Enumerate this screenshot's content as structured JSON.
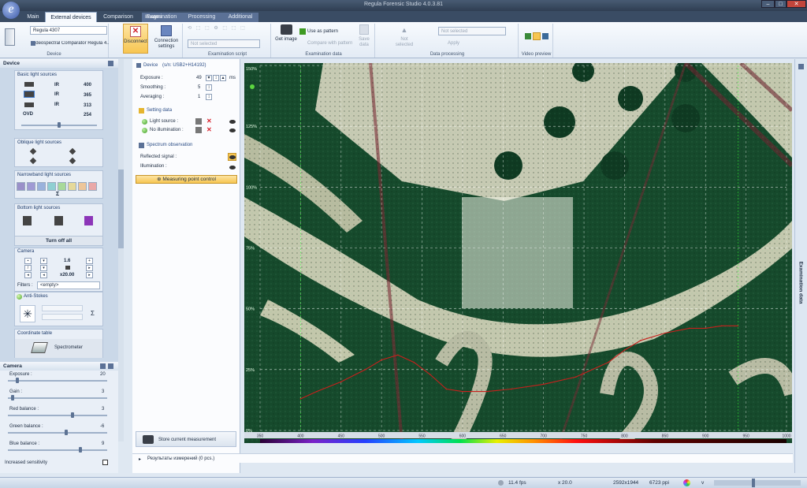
{
  "window": {
    "title": "Regula Forensic Studio 4.0.3.81",
    "context_tab": "Images"
  },
  "tabs": [
    {
      "label": "Main",
      "active": false
    },
    {
      "label": "External devices",
      "active": true
    },
    {
      "label": "Comparison",
      "active": false
    },
    {
      "label": "Examination",
      "active": false
    },
    {
      "label": "Processing",
      "active": false
    },
    {
      "label": "Additional",
      "active": false
    }
  ],
  "ribbon": {
    "device": {
      "combo": "Regula 4307",
      "desc": "Videospectral Comparator Regula 4...",
      "group": "Device"
    },
    "disconnect": "Disconnect",
    "connection_settings": "Connection settings",
    "script": {
      "combo": "Not selected",
      "group": "Examination script"
    },
    "get_image": "Get image",
    "use_as_pattern": "Use as pattern",
    "compare_with_pattern": "Compare with pattern",
    "save_data": "Save data",
    "exam_group": "Examination data",
    "not_selected": "Not selected",
    "processing": {
      "combo": "Not selected",
      "apply": "Apply",
      "group": "Data processing"
    },
    "video_group": "Video preview"
  },
  "device_panel": {
    "title": "Device",
    "basic": {
      "title": "Basic light sources",
      "rows": [
        {
          "tag": "IR",
          "value": "400"
        },
        {
          "tag": "IR",
          "value": "365"
        },
        {
          "tag": "IR",
          "value": "313"
        },
        {
          "tag": "OVD",
          "value": "254"
        }
      ]
    },
    "oblique": "Oblique light sources",
    "narrowband": {
      "title": "Narrowband light sources",
      "sigma": "Σ"
    },
    "bottom": {
      "title": "Bottom light sources",
      "turn_off": "Turn off all"
    },
    "camera": {
      "title": "Camera",
      "zoom": "1.6",
      "mag": "x20.00",
      "filters_label": "Filters :",
      "filters_value": "<empty>"
    },
    "anti_stokes": "Anti-Stokes",
    "coordinate_table": "Coordinate table",
    "spectrometer": "Spectrometer"
  },
  "camera_panel": {
    "title": "Camera",
    "exposure": {
      "label": "Exposure :",
      "value": "20"
    },
    "gain": {
      "label": "Gain :",
      "value": "3"
    },
    "red": {
      "label": "Red balance :",
      "value": "3"
    },
    "green": {
      "label": "Green balance :",
      "value": "-6"
    },
    "blue": {
      "label": "Blue balance :",
      "value": "9"
    },
    "increased_sensitivity": "Increased sensitivity"
  },
  "spectro": {
    "device": "Device",
    "serial": "(s/n: USB2+H14192)",
    "exposure": {
      "label": "Exposure :",
      "value": "49",
      "unit": "ms"
    },
    "smoothing": {
      "label": "Smoothing :",
      "value": "5"
    },
    "averaging": {
      "label": "Averaging :",
      "value": "1"
    },
    "setting_data": "Setting data",
    "light_source": "Light source :",
    "no_illumination": "No illumination :",
    "spectrum_observation": "Spectrum observation",
    "reflected_signal": "Reflected signal :",
    "illumination": "Illumination :",
    "measuring_point": "Measuring point control",
    "store": "Store current measurement"
  },
  "results": "Результаты измерений (0 pcs.)",
  "chart_data": {
    "type": "line",
    "x_ticks": [
      "350",
      "400",
      "450",
      "500",
      "550",
      "600",
      "650",
      "700",
      "750",
      "800",
      "850",
      "900",
      "950",
      "1000"
    ],
    "y_ticks": [
      "150%",
      "125%",
      "100%",
      "75%",
      "50%",
      "25%",
      "0%"
    ],
    "xlim": [
      350,
      1000
    ],
    "ylim": [
      0,
      150
    ],
    "grid": true,
    "series": [
      {
        "color": "#c8201c",
        "x": [
          400,
          420,
          450,
          480,
          500,
          520,
          540,
          560,
          580,
          600,
          630,
          660,
          700,
          740,
          780,
          800,
          820,
          850,
          880,
          900,
          920,
          940
        ],
        "y": [
          13,
          16,
          20,
          25,
          29,
          31,
          28,
          23,
          17,
          16,
          16,
          17,
          19,
          22,
          28,
          33,
          37,
          40,
          42,
          42,
          43,
          43
        ]
      }
    ]
  },
  "right_panel_title": "Examination data",
  "status": {
    "fps": "11.4 fps",
    "zoom": "x 20.0",
    "resolution": "2592x1944",
    "ppi": "6723 ppi",
    "v": "v"
  },
  "colors": {
    "accent": "#f7c652",
    "ribbon": "#e3ebf5",
    "curve": "#c8201c"
  }
}
